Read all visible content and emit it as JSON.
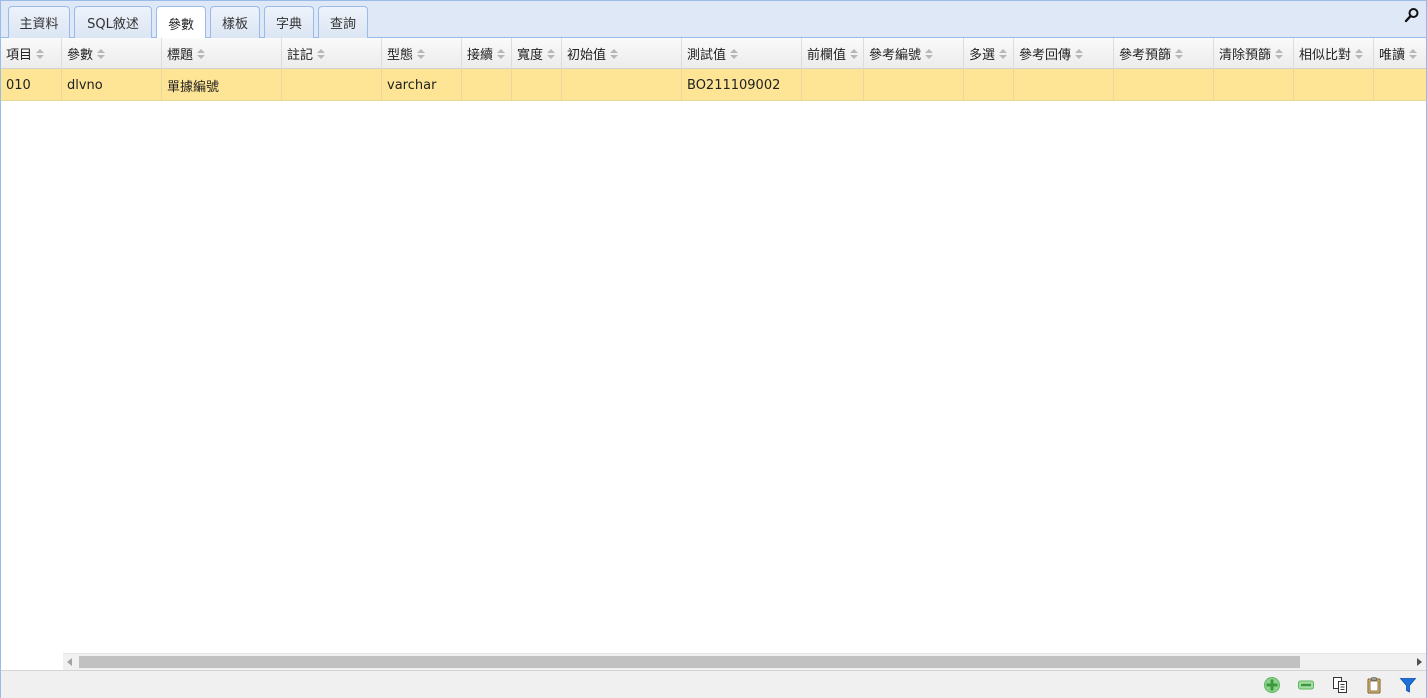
{
  "tabs": [
    {
      "label": "主資料",
      "active": false
    },
    {
      "label": "SQL敘述",
      "active": false
    },
    {
      "label": "參數",
      "active": true
    },
    {
      "label": "樣板",
      "active": false
    },
    {
      "label": "字典",
      "active": false
    },
    {
      "label": "查詢",
      "active": false
    }
  ],
  "grid": {
    "columns": [
      "項目",
      "參數",
      "標題",
      "註記",
      "型態",
      "接續",
      "寬度",
      "初始值",
      "測試值",
      "前欄值",
      "參考編號",
      "多選",
      "參考回傳",
      "參考預篩",
      "清除預篩",
      "相似比對",
      "唯讀"
    ],
    "rows": [
      [
        "010",
        "dlvno",
        "單據編號",
        "",
        "varchar",
        "",
        "",
        "",
        "BO211109002",
        "",
        "",
        "",
        "",
        "",
        "",
        "",
        ""
      ]
    ],
    "selected_row": 0
  },
  "icons": {
    "search": "search-icon",
    "add": "add-icon",
    "remove": "remove-icon",
    "copy": "copy-icon",
    "paste": "paste-icon",
    "filter": "filter-icon"
  },
  "colors": {
    "selected_row": "#fee595",
    "tab_strip": "#dfe8f6",
    "border": "#99bbe8",
    "add_green": "#5cb85c",
    "filter_blue": "#1e6fd9"
  }
}
